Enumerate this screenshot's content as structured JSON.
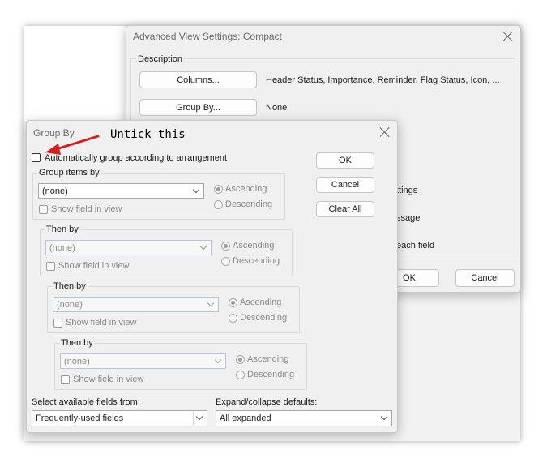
{
  "advanced": {
    "title": "Advanced View Settings: Compact",
    "description_label": "Description",
    "columns_button": "Columns...",
    "columns_value": "Header Status, Importance, Reminder, Flag Status, Icon, ...",
    "groupby_button": "Group By...",
    "groupby_value": "None",
    "partial_1": "ttings",
    "partial_2": "ssage",
    "partial_3": "each field",
    "ok": "OK",
    "cancel": "Cancel"
  },
  "groupby": {
    "title": "Group By",
    "auto_group_label": "Automatically group according to arrangement",
    "auto_group_checked": false,
    "ok": "OK",
    "cancel": "Cancel",
    "clear_all": "Clear All",
    "levels": [
      {
        "label": "Group items by",
        "field": "(none)",
        "show_field": "Show field in view",
        "ascending": "Ascending",
        "descending": "Descending"
      },
      {
        "label": "Then by",
        "field": "(none)",
        "show_field": "Show field in view",
        "ascending": "Ascending",
        "descending": "Descending"
      },
      {
        "label": "Then by",
        "field": "(none)",
        "show_field": "Show field in view",
        "ascending": "Ascending",
        "descending": "Descending"
      },
      {
        "label": "Then by",
        "field": "(none)",
        "show_field": "Show field in view",
        "ascending": "Ascending",
        "descending": "Descending"
      }
    ],
    "select_fields_label": "Select available fields from:",
    "select_fields_value": "Frequently-used fields",
    "expand_label": "Expand/collapse defaults:",
    "expand_value": "All expanded"
  },
  "annotation": {
    "text": "Untick this",
    "color": "#d32020"
  }
}
